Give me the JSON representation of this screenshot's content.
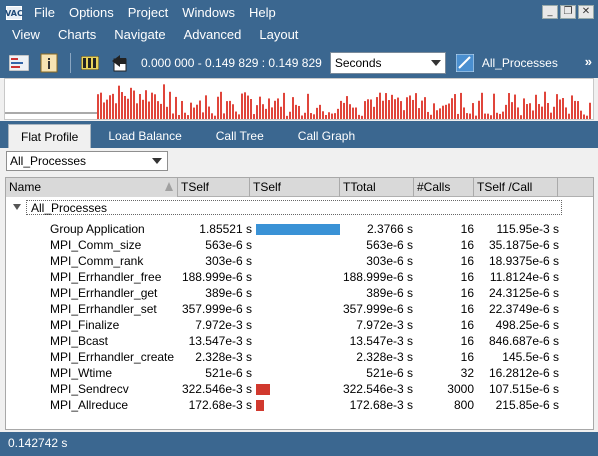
{
  "app": {
    "icon_text": "VAC"
  },
  "menu": [
    "File",
    "Options",
    "Project",
    "Windows",
    "Help"
  ],
  "menu2": [
    "View",
    "Charts",
    "Navigate",
    "Advanced",
    "Layout"
  ],
  "window_controls": [
    "_",
    "❐",
    "✕"
  ],
  "toolbar": {
    "time_range": "0.000 000 - 0.149 829 : 0.149 829",
    "units": "Seconds",
    "process_label": "All_Processes",
    "overflow": "»"
  },
  "tabs": [
    "Flat Profile",
    "Load Balance",
    "Call Tree",
    "Call Graph"
  ],
  "filter": {
    "value": "All_Processes"
  },
  "table": {
    "columns": [
      "Name",
      "TSelf",
      "TSelf",
      "TTotal",
      "#Calls",
      "TSelf /Call"
    ],
    "root": "All_Processes",
    "rows": [
      {
        "name": "Group Application",
        "tself": "1.85521 s",
        "bar_fraction": 1.0,
        "bar_color": "#3a92d6",
        "ttotal": "2.3766 s",
        "calls": "16",
        "tself_call": "115.95e-3 s"
      },
      {
        "name": "MPI_Comm_size",
        "tself": "563e-6 s",
        "bar_fraction": 0,
        "bar_color": "#d1392e",
        "ttotal": "563e-6 s",
        "calls": "16",
        "tself_call": "35.1875e-6 s"
      },
      {
        "name": "MPI_Comm_rank",
        "tself": "303e-6 s",
        "bar_fraction": 0,
        "bar_color": "#d1392e",
        "ttotal": "303e-6 s",
        "calls": "16",
        "tself_call": "18.9375e-6 s"
      },
      {
        "name": "MPI_Errhandler_free",
        "tself": "188.999e-6 s",
        "bar_fraction": 0,
        "bar_color": "#d1392e",
        "ttotal": "188.999e-6 s",
        "calls": "16",
        "tself_call": "11.8124e-6 s"
      },
      {
        "name": "MPI_Errhandler_get",
        "tself": "389e-6 s",
        "bar_fraction": 0,
        "bar_color": "#d1392e",
        "ttotal": "389e-6 s",
        "calls": "16",
        "tself_call": "24.3125e-6 s"
      },
      {
        "name": "MPI_Errhandler_set",
        "tself": "357.999e-6 s",
        "bar_fraction": 0,
        "bar_color": "#d1392e",
        "ttotal": "357.999e-6 s",
        "calls": "16",
        "tself_call": "22.3749e-6 s"
      },
      {
        "name": "MPI_Finalize",
        "tself": "7.972e-3 s",
        "bar_fraction": 0,
        "bar_color": "#d1392e",
        "ttotal": "7.972e-3 s",
        "calls": "16",
        "tself_call": "498.25e-6 s"
      },
      {
        "name": "MPI_Bcast",
        "tself": "13.547e-3 s",
        "bar_fraction": 0,
        "bar_color": "#d1392e",
        "ttotal": "13.547e-3 s",
        "calls": "16",
        "tself_call": "846.687e-6 s"
      },
      {
        "name": "MPI_Errhandler_create",
        "tself": "2.328e-3 s",
        "bar_fraction": 0,
        "bar_color": "#d1392e",
        "ttotal": "2.328e-3 s",
        "calls": "16",
        "tself_call": "145.5e-6 s"
      },
      {
        "name": "MPI_Wtime",
        "tself": "521e-6 s",
        "bar_fraction": 0,
        "bar_color": "#d1392e",
        "ttotal": "521e-6 s",
        "calls": "32",
        "tself_call": "16.2812e-6 s"
      },
      {
        "name": "MPI_Sendrecv",
        "tself": "322.546e-3 s",
        "bar_fraction": 0.17,
        "bar_color": "#d1392e",
        "ttotal": "322.546e-3 s",
        "calls": "3000",
        "tself_call": "107.515e-6 s"
      },
      {
        "name": "MPI_Allreduce",
        "tself": "172.68e-3 s",
        "bar_fraction": 0.09,
        "bar_color": "#d1392e",
        "ttotal": "172.68e-3 s",
        "calls": "800",
        "tself_call": "215.85e-6 s"
      }
    ]
  },
  "timeline": {
    "bar_color": "#e0453b",
    "level_color": "#555555"
  },
  "status": {
    "text": "0.142742 s"
  }
}
